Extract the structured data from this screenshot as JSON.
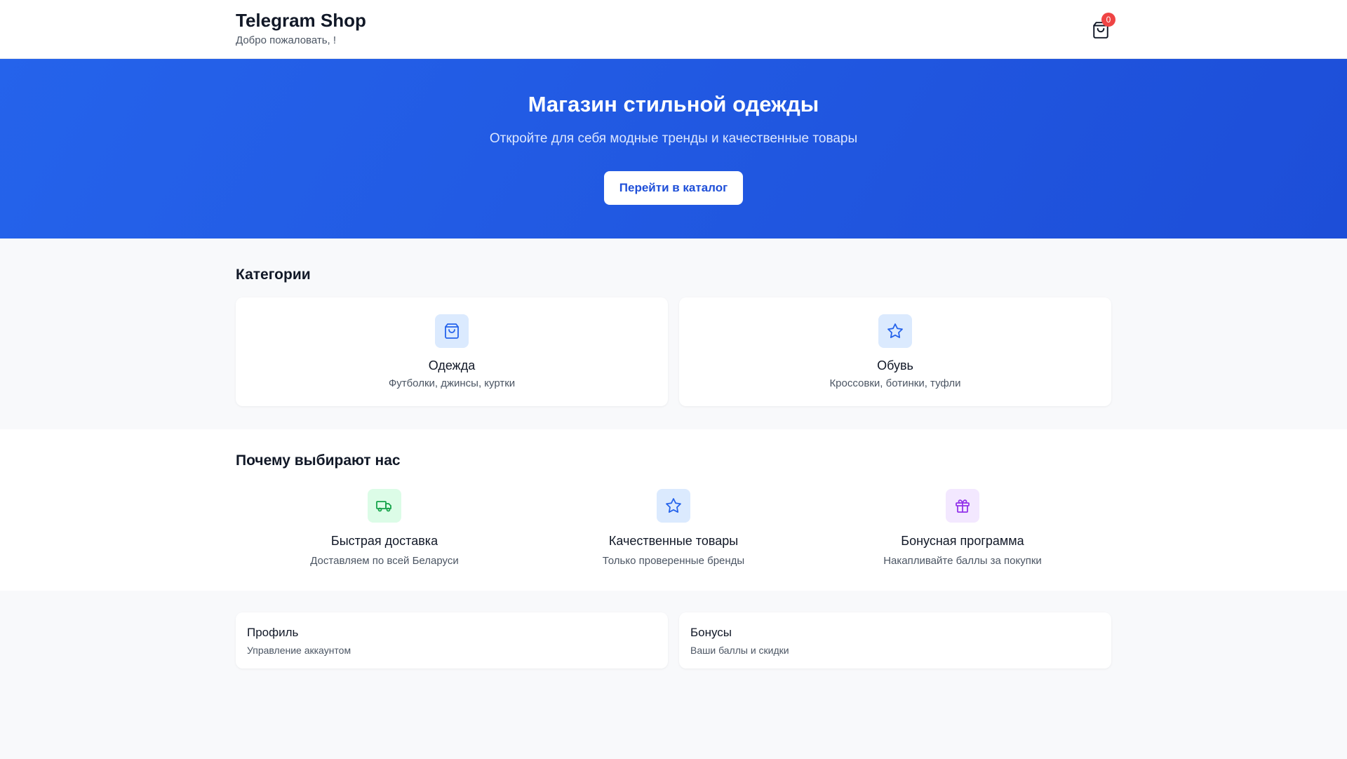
{
  "header": {
    "title": "Telegram Shop",
    "subtitle": "Добро пожаловать, !",
    "cart_count": "0",
    "cart_icon": "shopping-bag-icon"
  },
  "hero": {
    "title": "Магазин стильной одежды",
    "subtitle": "Откройте для себя модные тренды и качественные товары",
    "button_label": "Перейти в каталог"
  },
  "categories": {
    "title": "Категории",
    "items": [
      {
        "name": "Одежда",
        "description": "Футболки, джинсы, куртки",
        "icon": "shopping-bag-icon"
      },
      {
        "name": "Обувь",
        "description": "Кроссовки, ботинки, туфли",
        "icon": "star-icon"
      }
    ]
  },
  "why": {
    "title": "Почему выбирают нас",
    "features": [
      {
        "title": "Быстрая доставка",
        "description": "Доставляем по всей Беларуси",
        "icon": "truck-icon",
        "color": "#16a34a",
        "bg": "#dcfce7"
      },
      {
        "title": "Качественные товары",
        "description": "Только проверенные бренды",
        "icon": "star-icon",
        "color": "#2563eb",
        "bg": "#dbeafe"
      },
      {
        "title": "Бонусная программа",
        "description": "Накапливайте баллы за покупки",
        "icon": "gift-icon",
        "color": "#9333ea",
        "bg": "#f3e8ff"
      }
    ]
  },
  "links": [
    {
      "title": "Профиль",
      "description": "Управление аккаунтом"
    },
    {
      "title": "Бонусы",
      "description": "Ваши баллы и скидки"
    }
  ],
  "colors": {
    "accent": "#2563eb",
    "badge": "#ef4444"
  }
}
